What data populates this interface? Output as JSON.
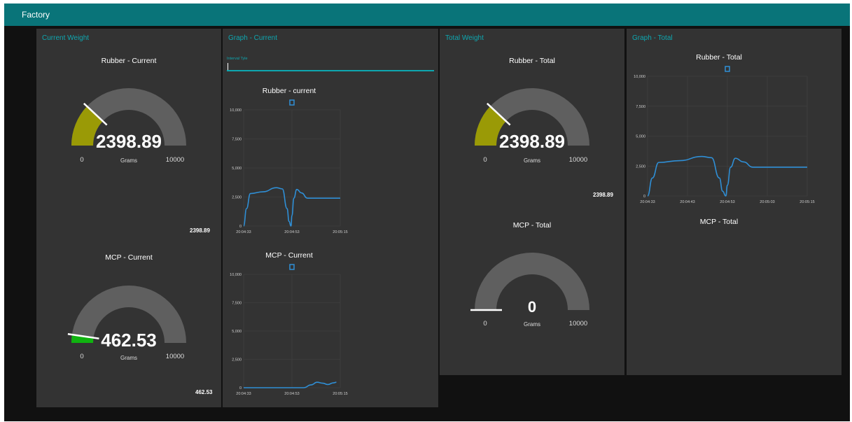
{
  "app": {
    "title": "Factory"
  },
  "colors": {
    "toolbar": "#097479",
    "accent": "#0ea7b0",
    "card": "#333333",
    "gauge_track": "#5f5f5f",
    "series": "#2f8fd6",
    "rubber_gauge": "#9a9a06",
    "mcp_gauge": "#10b310"
  },
  "cards": {
    "current_weight": {
      "title": "Current Weight",
      "rubber": {
        "title": "Rubber - Current",
        "value": 2398.89,
        "value_text": "2398.89",
        "min": "0",
        "max": "10000",
        "units": "Grams",
        "text_value": "2398.89"
      },
      "mcp": {
        "title": "MCP - Current",
        "value": 462.53,
        "value_text": "462.53",
        "min": "0",
        "max": "10000",
        "units": "Grams",
        "text_value": "462.53"
      }
    },
    "graph_current": {
      "title": "Graph - Current",
      "interval_label": "Interval Tyle",
      "interval_value": "",
      "rubber_title": "Rubber - current",
      "mcp_title": "MCP - Current"
    },
    "total_weight": {
      "title": "Total Weight",
      "rubber": {
        "title": "Rubber - Total",
        "value": 2398.89,
        "value_text": "2398.89",
        "min": "0",
        "max": "10000",
        "units": "Grams",
        "text_value": "2398.89"
      },
      "mcp": {
        "title": "MCP - Total",
        "value": 0,
        "value_text": "0",
        "min": "0",
        "max": "10000",
        "units": "Grams"
      }
    },
    "graph_total": {
      "title": "Graph - Total",
      "rubber_title": "Rubber - Total",
      "mcp_title": "MCP - Total"
    }
  },
  "chart_data": [
    {
      "id": "rubber_current",
      "type": "line",
      "title": "Rubber - current",
      "ylim": [
        0,
        10000
      ],
      "y_ticks": [
        "0",
        "2,500",
        "5,000",
        "7,500",
        "10,000"
      ],
      "x_ticks": [
        "20:04:33",
        "20:04:53",
        "20:05:15"
      ],
      "grid": true,
      "series": [
        {
          "values": [
            [
              0,
              0
            ],
            [
              0.03,
              1500
            ],
            [
              0.07,
              2800
            ],
            [
              0.2,
              2950
            ],
            [
              0.34,
              3300
            ],
            [
              0.4,
              3200
            ],
            [
              0.45,
              1500
            ],
            [
              0.47,
              400
            ],
            [
              0.49,
              0
            ],
            [
              0.5,
              900
            ],
            [
              0.52,
              2400
            ],
            [
              0.55,
              3150
            ],
            [
              0.6,
              2850
            ],
            [
              0.66,
              2400
            ],
            [
              0.75,
              2400
            ],
            [
              1.0,
              2400
            ]
          ]
        }
      ]
    },
    {
      "id": "mcp_current",
      "type": "line",
      "title": "MCP - Current",
      "ylim": [
        0,
        10000
      ],
      "y_ticks": [
        "0",
        "2,500",
        "5,000",
        "7,500",
        "10,000"
      ],
      "x_ticks": [
        "20:04:33",
        "20:04:53",
        "20:05:15"
      ],
      "grid": true,
      "series": [
        {
          "values": [
            [
              0.0,
              0
            ],
            [
              0.62,
              0
            ],
            [
              0.7,
              250
            ],
            [
              0.76,
              480
            ],
            [
              0.82,
              400
            ],
            [
              0.87,
              280
            ],
            [
              0.93,
              430
            ],
            [
              0.96,
              480
            ]
          ]
        }
      ]
    },
    {
      "id": "rubber_total",
      "type": "line",
      "title": "Rubber - Total",
      "ylim": [
        0,
        10000
      ],
      "y_ticks": [
        "0",
        "2,500",
        "5,000",
        "7,500",
        "10,000"
      ],
      "x_ticks": [
        "20:04:33",
        "20:04:43",
        "20:04:53",
        "20:05:03",
        "20:05:15"
      ],
      "grid": true,
      "series": [
        {
          "values": [
            [
              0,
              0
            ],
            [
              0.03,
              1500
            ],
            [
              0.07,
              2800
            ],
            [
              0.2,
              2950
            ],
            [
              0.34,
              3300
            ],
            [
              0.4,
              3200
            ],
            [
              0.45,
              1500
            ],
            [
              0.47,
              400
            ],
            [
              0.49,
              0
            ],
            [
              0.5,
              900
            ],
            [
              0.52,
              2400
            ],
            [
              0.55,
              3150
            ],
            [
              0.6,
              2850
            ],
            [
              0.66,
              2400
            ],
            [
              0.75,
              2400
            ],
            [
              1.0,
              2400
            ]
          ]
        }
      ]
    }
  ]
}
